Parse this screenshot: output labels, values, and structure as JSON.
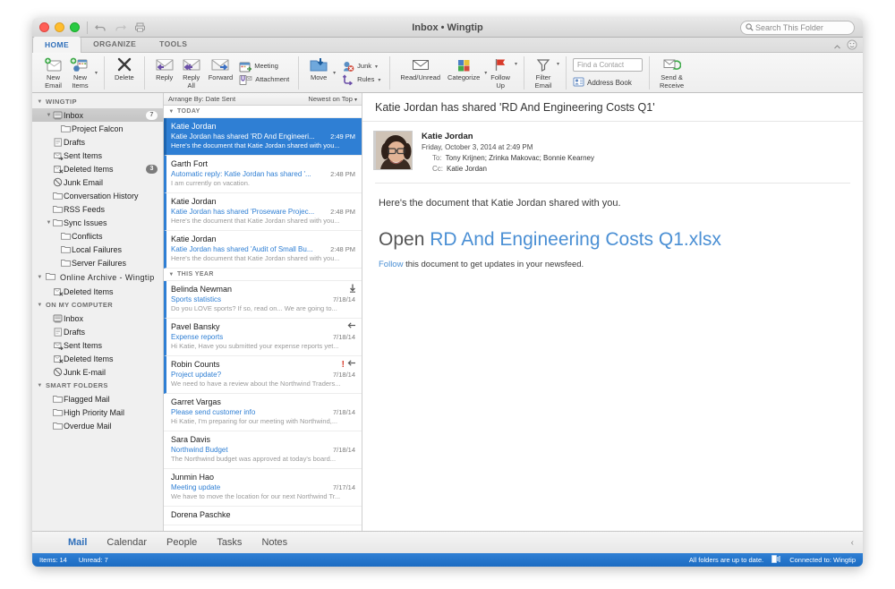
{
  "window": {
    "title": "Inbox • Wingtip",
    "search_placeholder": "Search This Folder"
  },
  "ribbon_tabs": [
    {
      "label": "HOME",
      "active": true
    },
    {
      "label": "ORGANIZE",
      "active": false
    },
    {
      "label": "TOOLS",
      "active": false
    }
  ],
  "ribbon": {
    "new_email": "New\nEmail",
    "new_items": "New\nItems",
    "delete": "Delete",
    "reply": "Reply",
    "reply_all": "Reply\nAll",
    "forward": "Forward",
    "meeting": "Meeting",
    "attachment": "Attachment",
    "move": "Move",
    "junk": "Junk",
    "rules": "Rules",
    "read_unread": "Read/Unread",
    "categorize": "Categorize",
    "follow_up": "Follow\nUp",
    "filter_email": "Filter\nEmail",
    "find_contact_placeholder": "Find a Contact",
    "address_book": "Address Book",
    "send_receive": "Send &\nReceive"
  },
  "sidebar": {
    "groups": [
      {
        "name": "WINGTIP",
        "items": [
          {
            "label": "Inbox",
            "icon": "inbox-icon",
            "indent": 1,
            "selected": true,
            "badge": "7",
            "badge_light": true,
            "twisty": true
          },
          {
            "label": "Project Falcon",
            "icon": "folder-icon",
            "indent": 2
          },
          {
            "label": "Drafts",
            "icon": "drafts-icon",
            "indent": 1
          },
          {
            "label": "Sent Items",
            "icon": "sent-icon",
            "indent": 1
          },
          {
            "label": "Deleted Items",
            "icon": "deleted-icon",
            "indent": 1,
            "badge": "3"
          },
          {
            "label": "Junk Email",
            "icon": "junk-icon",
            "indent": 1
          },
          {
            "label": "Conversation History",
            "icon": "folder-icon",
            "indent": 1
          },
          {
            "label": "RSS Feeds",
            "icon": "folder-icon",
            "indent": 1
          },
          {
            "label": "Sync Issues",
            "icon": "folder-icon",
            "indent": 1,
            "twisty": true
          },
          {
            "label": "Conflicts",
            "icon": "folder-icon",
            "indent": 2
          },
          {
            "label": "Local Failures",
            "icon": "folder-icon",
            "indent": 2
          },
          {
            "label": "Server Failures",
            "icon": "folder-icon",
            "indent": 2
          }
        ]
      },
      {
        "name": "Online Archive - Wingtip",
        "is_folder_header": true,
        "items": [
          {
            "label": "Deleted Items",
            "icon": "deleted-icon",
            "indent": 1
          }
        ]
      },
      {
        "name": "ON MY COMPUTER",
        "items": [
          {
            "label": "Inbox",
            "icon": "inbox-icon",
            "indent": 1
          },
          {
            "label": "Drafts",
            "icon": "drafts-icon",
            "indent": 1
          },
          {
            "label": "Sent Items",
            "icon": "sent-icon",
            "indent": 1
          },
          {
            "label": "Deleted Items",
            "icon": "deleted-icon",
            "indent": 1
          },
          {
            "label": "Junk E-mail",
            "icon": "junk-icon",
            "indent": 1
          }
        ]
      },
      {
        "name": "SMART FOLDERS",
        "items": [
          {
            "label": "Flagged Mail",
            "icon": "folder-icon",
            "indent": 1
          },
          {
            "label": "High Priority Mail",
            "icon": "folder-icon",
            "indent": 1
          },
          {
            "label": "Overdue Mail",
            "icon": "folder-icon",
            "indent": 1
          }
        ]
      }
    ]
  },
  "message_list": {
    "arrange_by": "Arrange By: Date Sent",
    "sort_order": "Newest on Top",
    "sections": [
      {
        "title": "TODAY",
        "messages": [
          {
            "from": "Katie Jordan",
            "subject": "Katie Jordan has shared 'RD And Engineeri...",
            "preview": "Here's the document that Katie Jordan shared with you...",
            "date": "2:49 PM",
            "selected": true,
            "unread": true,
            "flags": []
          },
          {
            "from": "Garth Fort",
            "subject": "Automatic reply: Katie Jordan has shared '...",
            "preview": "I am currently on vacation.",
            "date": "2:48 PM",
            "selected": false,
            "unread": true,
            "flags": []
          },
          {
            "from": "Katie Jordan",
            "subject": "Katie Jordan has shared 'Proseware Projec...",
            "preview": "Here's the document that Katie Jordan shared with you...",
            "date": "2:48 PM",
            "selected": false,
            "unread": true,
            "flags": []
          },
          {
            "from": "Katie Jordan",
            "subject": "Katie Jordan has shared 'Audit of Small Bu...",
            "preview": "Here's the document that Katie Jordan shared with you...",
            "date": "2:48 PM",
            "selected": false,
            "unread": true,
            "flags": []
          }
        ]
      },
      {
        "title": "THIS YEAR",
        "messages": [
          {
            "from": "Belinda Newman",
            "subject": "Sports statistics",
            "preview": "Do you LOVE sports? If so, read on... We are going to...",
            "date": "7/18/14",
            "selected": false,
            "unread": true,
            "flags": [
              "download-icon"
            ]
          },
          {
            "from": "Pavel Bansky",
            "subject": "Expense reports",
            "preview": "Hi Katie, Have you submitted your expense reports yet...",
            "date": "7/18/14",
            "selected": false,
            "unread": true,
            "flags": [
              "replied-icon"
            ]
          },
          {
            "from": "Robin Counts",
            "subject": "Project update?",
            "preview": "We need to have a review about the Northwind Traders...",
            "date": "7/18/14",
            "selected": false,
            "unread": true,
            "flags": [
              "high-priority-icon",
              "replied-icon"
            ]
          },
          {
            "from": "Garret Vargas",
            "subject": "Please send customer info",
            "preview": "Hi Katie, I'm preparing for our meeting with Northwind,...",
            "date": "7/18/14",
            "selected": false,
            "unread": false,
            "flags": []
          },
          {
            "from": "Sara Davis",
            "subject": "Northwind Budget",
            "preview": "The Northwind budget was approved at today's board...",
            "date": "7/18/14",
            "selected": false,
            "unread": false,
            "flags": []
          },
          {
            "from": "Junmin Hao",
            "subject": "Meeting update",
            "preview": "We have to move the location for our next Northwind Tr...",
            "date": "7/17/14",
            "selected": false,
            "unread": false,
            "flags": []
          },
          {
            "from": "Dorena Paschke",
            "subject": "",
            "preview": "",
            "date": "",
            "selected": false,
            "unread": false,
            "flags": []
          }
        ]
      }
    ]
  },
  "reader": {
    "title": "Katie Jordan has shared 'RD And Engineering Costs Q1'",
    "sender": "Katie Jordan",
    "date": "Friday, October 3, 2014 at 2:49 PM",
    "to_label": "To:",
    "to_value": "Tony Krijnen;   Zrinka Makovac;   Bonnie Kearney",
    "cc_label": "Cc:",
    "cc_value": "Katie Jordan",
    "body_paragraph": "Here's the document that Katie Jordan shared with you.",
    "open_prefix": "Open",
    "open_link": "RD And Engineering Costs Q1.xlsx",
    "follow_link": "Follow",
    "follow_rest": "this document to get updates in your newsfeed."
  },
  "bottom_nav": {
    "items": [
      {
        "label": "Mail",
        "active": true
      },
      {
        "label": "Calendar",
        "active": false
      },
      {
        "label": "People",
        "active": false
      },
      {
        "label": "Tasks",
        "active": false
      },
      {
        "label": "Notes",
        "active": false
      }
    ]
  },
  "status_bar": {
    "items_count": "Items: 14",
    "unread_count": "Unread: 7",
    "sync_status": "All folders are up to date.",
    "connection": "Connected to: Wingtip"
  },
  "colors": {
    "accent_blue": "#2f7fd4",
    "link_blue": "#4a8fd4",
    "status_bar": "#1c6cc2",
    "tab_active": "#2f6fba"
  }
}
